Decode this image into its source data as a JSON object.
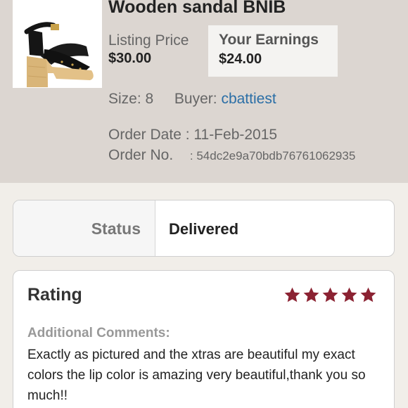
{
  "listing": {
    "title": "Wooden sandal BNIB",
    "image_icon": "wooden-platform-sandal-photo",
    "listing_price_label": "Listing Price",
    "listing_price": "$30.00",
    "earnings_label": "Your Earnings",
    "earnings": "$24.00",
    "size_label": "Size:",
    "size": "8",
    "buyer_label": "Buyer:",
    "buyer": "cbattiest",
    "order_date_label": "Order Date",
    "order_date": ": 11-Feb-2015",
    "order_no_label": "Order No.",
    "order_no": ": 54dc2e9a70bdb76761062935"
  },
  "status": {
    "label": "Status",
    "value": "Delivered"
  },
  "rating": {
    "title": "Rating",
    "stars": 5,
    "star_color": "#8b2232",
    "comments_label": "Additional Comments:",
    "comments": "Exactly as pictured and the xtras are beautiful my exact colors the lip color is amazing very beautiful,thank you so much!!"
  },
  "colors": {
    "header_bg": "#dcd6d1",
    "link": "#2a6ea6"
  }
}
